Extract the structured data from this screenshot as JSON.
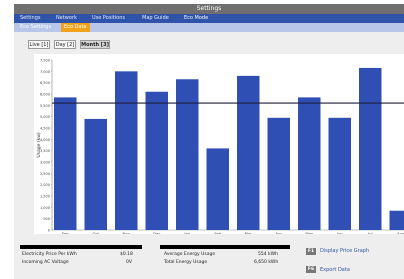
{
  "window": {
    "title": "Settings"
  },
  "menu": {
    "items": [
      {
        "label": "Settings"
      },
      {
        "label": "Network"
      },
      {
        "label": "Use Positions"
      },
      {
        "label": "Map Guide"
      },
      {
        "label": "Eco Mode"
      }
    ],
    "active_index": 4
  },
  "subtabs": [
    {
      "label": "Eco Settings"
    },
    {
      "label": "Eco Data"
    }
  ],
  "range_buttons": [
    {
      "label": "Live [1]"
    },
    {
      "label": "Day [2]"
    },
    {
      "label": "Month [3]"
    }
  ],
  "chart_data": {
    "type": "bar",
    "categories": [
      "Sep",
      "Oct",
      "Nov",
      "Dec",
      "Jan",
      "Feb",
      "Mar",
      "Apr",
      "May",
      "Jun",
      "Jul",
      "Aug"
    ],
    "values": [
      5850,
      4900,
      7000,
      6100,
      6650,
      3600,
      6800,
      4950,
      5850,
      4950,
      7150,
      850
    ],
    "reference_line": 5600,
    "ylim": [
      0,
      7500
    ],
    "yticks": [
      0,
      500,
      1000,
      1500,
      2000,
      2500,
      3000,
      3500,
      4000,
      4500,
      5000,
      5500,
      6000,
      6500,
      7000,
      7500
    ],
    "ytick_labels": [
      "0",
      "500",
      "1,000",
      "1,500",
      "2,000",
      "2,500",
      "3,000",
      "3,500",
      "4,000",
      "4,500",
      "5,000",
      "5,500",
      "6,000",
      "6,500",
      "7,000",
      "7,500"
    ],
    "ylabel": "Usage (kw)",
    "bar_color": "#2f4fb4",
    "line_color": "#1e1e3a",
    "grid": false
  },
  "stats": {
    "price_label": "Electricity Price Per kWh",
    "price_value": "$0.18",
    "voltage_label": "Incoming AC Voltage",
    "voltage_value": "0V",
    "avg_label": "Average Energy Usage",
    "avg_value": "554 kWh",
    "total_label": "Total Energy Usage",
    "total_value": "6,650 kWh"
  },
  "actions": [
    {
      "key": "F1",
      "label": "Display Price Graph"
    },
    {
      "key": "F6",
      "label": "Export Data"
    }
  ]
}
